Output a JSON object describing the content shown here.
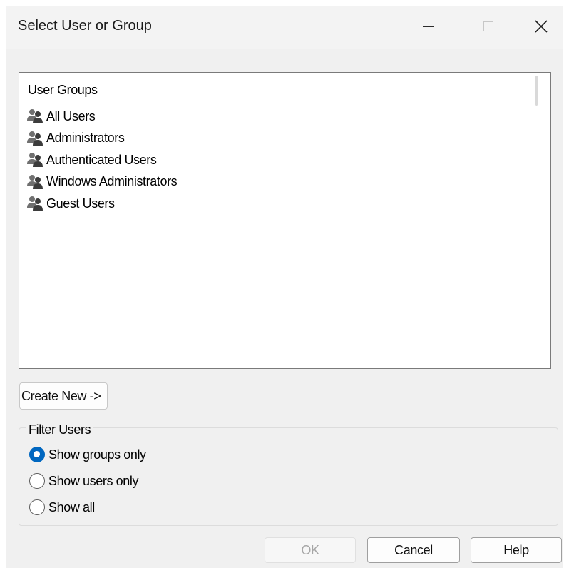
{
  "window": {
    "title": "Select User or Group",
    "controls": {
      "minimize": "minimize",
      "maximize": "maximize",
      "close": "close"
    }
  },
  "list": {
    "header": "User Groups",
    "items": [
      {
        "label": "All Users",
        "icon": "group-icon"
      },
      {
        "label": "Administrators",
        "icon": "group-icon"
      },
      {
        "label": "Authenticated Users",
        "icon": "group-icon"
      },
      {
        "label": "Windows Administrators",
        "icon": "group-icon"
      },
      {
        "label": "Guest Users",
        "icon": "group-icon"
      }
    ]
  },
  "actions": {
    "create_new": "Create New ->"
  },
  "filter": {
    "legend": "Filter Users",
    "options": [
      {
        "label": "Show groups only",
        "checked": true
      },
      {
        "label": "Show users only",
        "checked": false
      },
      {
        "label": "Show all",
        "checked": false
      }
    ]
  },
  "footer": {
    "ok": "OK",
    "cancel": "Cancel",
    "help": "Help"
  },
  "colors": {
    "accent": "#0067c0",
    "disabled_text": "#a6a6a6"
  }
}
